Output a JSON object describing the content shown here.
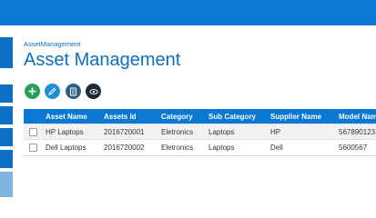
{
  "colors": {
    "accent": "#0b78d4",
    "sidebar_tile": "#0b6fc4",
    "add_button": "#27a05a",
    "edit_button": "#1f8fd8",
    "delete_button": "#2d5f82",
    "view_button": "#1e2a36"
  },
  "breadcrumb": "AssetManagement",
  "page_title": "Asset Management",
  "toolbar": {
    "buttons": [
      {
        "name": "add-button",
        "icon": "plus-icon"
      },
      {
        "name": "edit-button",
        "icon": "pencil-icon"
      },
      {
        "name": "delete-button",
        "icon": "trash-icon"
      },
      {
        "name": "view-button",
        "icon": "eye-icon"
      }
    ]
  },
  "table": {
    "columns": [
      "Asset Name",
      "Assets Id",
      "Category",
      "Sub Category",
      "Supplier Name",
      "Model Name"
    ],
    "rows": [
      {
        "asset_name": "HP Laptops",
        "assets_id": "2016720001",
        "category": "Eletronics",
        "sub_category": "Laptops",
        "supplier_name": "HP",
        "model_name": "567890123"
      },
      {
        "asset_name": "Dell Laptops",
        "assets_id": "2016720002",
        "category": "Eletronics",
        "sub_category": "Laptops",
        "supplier_name": "Dell",
        "model_name": "5600567"
      }
    ]
  }
}
